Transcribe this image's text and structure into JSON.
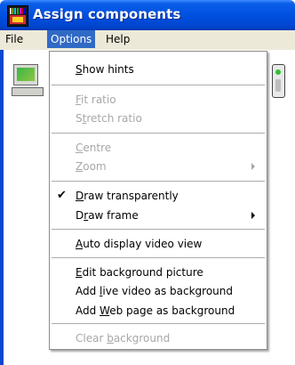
{
  "window": {
    "title": "Assign components"
  },
  "menubar": {
    "file": "File",
    "options": "Options",
    "help": "Help"
  },
  "options_menu": {
    "items": [
      {
        "pre": "",
        "ul": "S",
        "post": "how hints"
      },
      {
        "pre": "",
        "ul": "F",
        "post": "it ratio"
      },
      {
        "pre": "S",
        "ul": "t",
        "post": "retch ratio"
      },
      {
        "pre": "",
        "ul": "C",
        "post": "entre"
      },
      {
        "pre": "",
        "ul": "Z",
        "post": "oom"
      },
      {
        "pre": "",
        "ul": "D",
        "post": "raw transparently"
      },
      {
        "pre": "D",
        "ul": "r",
        "post": "aw frame"
      },
      {
        "pre": "",
        "ul": "A",
        "post": "uto display video view"
      },
      {
        "pre": "",
        "ul": "E",
        "post": "dit background picture"
      },
      {
        "pre": "Add ",
        "ul": "l",
        "post": "ive video as background"
      },
      {
        "pre": "Add ",
        "ul": "W",
        "post": "eb page as background"
      },
      {
        "pre": "Clear ",
        "ul": "b",
        "post": "ackground"
      }
    ]
  }
}
